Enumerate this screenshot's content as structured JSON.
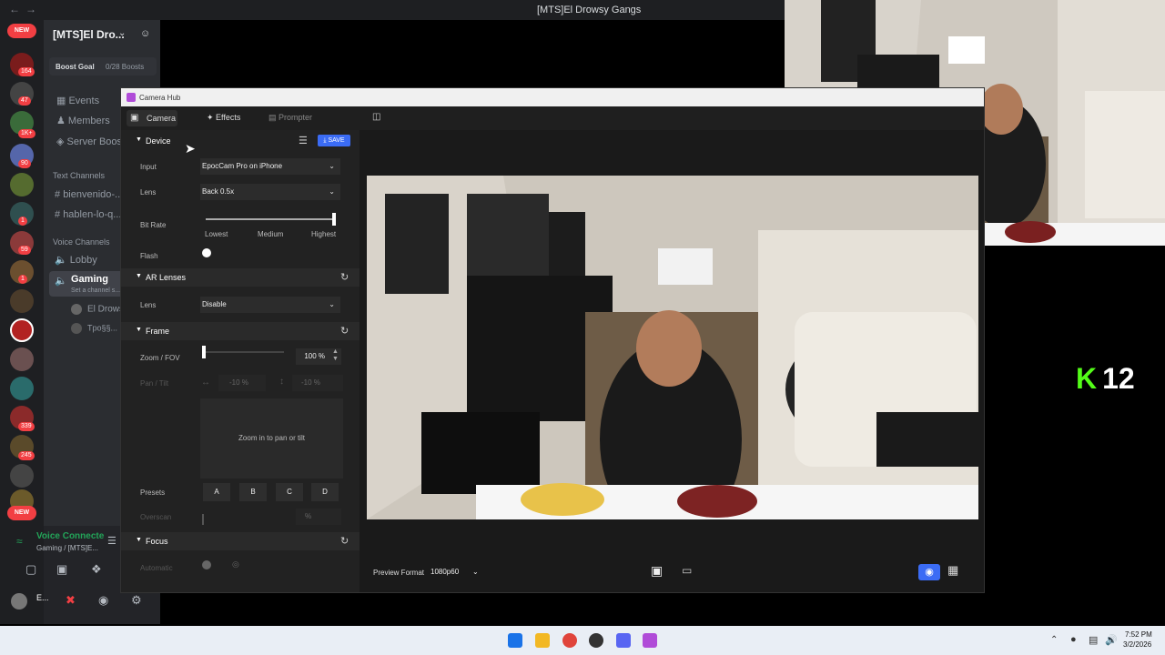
{
  "window": {
    "title": "[MTS]El Drowsy Gangs"
  },
  "rail": {
    "new_top": "NEW",
    "new_bottom": "NEW",
    "badges": [
      "164",
      "47",
      "1K+",
      "90",
      "1",
      "1",
      "59",
      "1",
      "339",
      "245"
    ]
  },
  "sidebar": {
    "server_name": "[MTS]El Dro...",
    "boost_goal": "Boost Goal",
    "boost_count": "0/28 Boosts",
    "items": [
      "Events",
      "Members",
      "Server Boos"
    ],
    "text_channels_label": "Text Channels",
    "text_channels": [
      "bienvenido-...",
      "hablen-lo-q..."
    ],
    "voice_channels_label": "Voice Channels",
    "voice_channels": [
      "Lobby",
      "Gaming"
    ],
    "voice_sub": "Set a channel s...",
    "voice_members": [
      "El Drows",
      "Tpo§§..."
    ],
    "voice_connected": "Voice Connecte",
    "voice_location": "Gaming / [MTS]E...",
    "user_short": "E..."
  },
  "hub": {
    "title": "Camera Hub",
    "tabs": [
      "Camera",
      "Effects",
      "Prompter"
    ],
    "device": {
      "header": "Device",
      "save": "SAVE",
      "input_label": "Input",
      "input_value": "EpocCam Pro on iPhone",
      "lens_label": "Lens",
      "lens_value": "Back 0.5x",
      "bitrate_label": "Bit Rate",
      "bitrate_ticks": [
        "Lowest",
        "Medium",
        "Highest"
      ],
      "bitrate_level": 1.0,
      "flash_label": "Flash"
    },
    "ar": {
      "header": "AR Lenses",
      "lens_label": "Lens",
      "lens_value": "Disable"
    },
    "frame": {
      "header": "Frame",
      "zoom_label": "Zoom / FOV",
      "zoom_value": "100 %",
      "pan_label": "Pan / Tilt",
      "pan_value": "-10 %",
      "tilt_value": "-10 %",
      "pad_text": "Zoom in to pan or tilt",
      "presets_label": "Presets",
      "presets": [
        "A",
        "B",
        "C",
        "D"
      ],
      "overscan_label": "Overscan",
      "overscan_unit": "%"
    },
    "focus": {
      "header": "Focus",
      "auto_label": "Automatic"
    },
    "preview_format_label": "Preview Format",
    "preview_format_value": "1080p60"
  },
  "overlay": {
    "kick_count": "12"
  },
  "taskbar": {
    "time": "7:52 PM",
    "date": "3/2/2026"
  },
  "colors": {
    "accent": "#3b6cf5",
    "discord_red": "#f23f43",
    "kick_green": "#53fc18"
  }
}
